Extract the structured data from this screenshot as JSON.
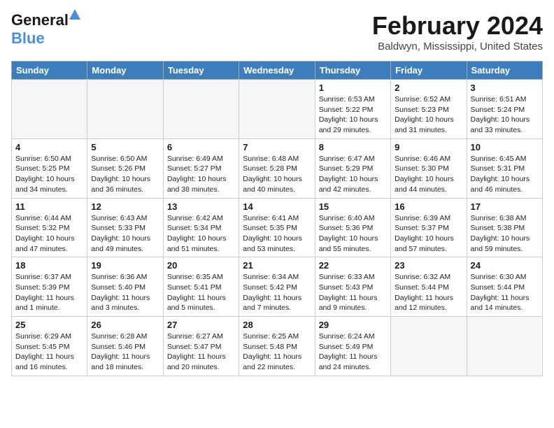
{
  "header": {
    "logo_line1": "General",
    "logo_line2": "Blue",
    "title": "February 2024",
    "subtitle": "Baldwyn, Mississippi, United States"
  },
  "days_of_week": [
    "Sunday",
    "Monday",
    "Tuesday",
    "Wednesday",
    "Thursday",
    "Friday",
    "Saturday"
  ],
  "weeks": [
    [
      {
        "day": "",
        "info": ""
      },
      {
        "day": "",
        "info": ""
      },
      {
        "day": "",
        "info": ""
      },
      {
        "day": "",
        "info": ""
      },
      {
        "day": "1",
        "info": "Sunrise: 6:53 AM\nSunset: 5:22 PM\nDaylight: 10 hours\nand 29 minutes."
      },
      {
        "day": "2",
        "info": "Sunrise: 6:52 AM\nSunset: 5:23 PM\nDaylight: 10 hours\nand 31 minutes."
      },
      {
        "day": "3",
        "info": "Sunrise: 6:51 AM\nSunset: 5:24 PM\nDaylight: 10 hours\nand 33 minutes."
      }
    ],
    [
      {
        "day": "4",
        "info": "Sunrise: 6:50 AM\nSunset: 5:25 PM\nDaylight: 10 hours\nand 34 minutes."
      },
      {
        "day": "5",
        "info": "Sunrise: 6:50 AM\nSunset: 5:26 PM\nDaylight: 10 hours\nand 36 minutes."
      },
      {
        "day": "6",
        "info": "Sunrise: 6:49 AM\nSunset: 5:27 PM\nDaylight: 10 hours\nand 38 minutes."
      },
      {
        "day": "7",
        "info": "Sunrise: 6:48 AM\nSunset: 5:28 PM\nDaylight: 10 hours\nand 40 minutes."
      },
      {
        "day": "8",
        "info": "Sunrise: 6:47 AM\nSunset: 5:29 PM\nDaylight: 10 hours\nand 42 minutes."
      },
      {
        "day": "9",
        "info": "Sunrise: 6:46 AM\nSunset: 5:30 PM\nDaylight: 10 hours\nand 44 minutes."
      },
      {
        "day": "10",
        "info": "Sunrise: 6:45 AM\nSunset: 5:31 PM\nDaylight: 10 hours\nand 46 minutes."
      }
    ],
    [
      {
        "day": "11",
        "info": "Sunrise: 6:44 AM\nSunset: 5:32 PM\nDaylight: 10 hours\nand 47 minutes."
      },
      {
        "day": "12",
        "info": "Sunrise: 6:43 AM\nSunset: 5:33 PM\nDaylight: 10 hours\nand 49 minutes."
      },
      {
        "day": "13",
        "info": "Sunrise: 6:42 AM\nSunset: 5:34 PM\nDaylight: 10 hours\nand 51 minutes."
      },
      {
        "day": "14",
        "info": "Sunrise: 6:41 AM\nSunset: 5:35 PM\nDaylight: 10 hours\nand 53 minutes."
      },
      {
        "day": "15",
        "info": "Sunrise: 6:40 AM\nSunset: 5:36 PM\nDaylight: 10 hours\nand 55 minutes."
      },
      {
        "day": "16",
        "info": "Sunrise: 6:39 AM\nSunset: 5:37 PM\nDaylight: 10 hours\nand 57 minutes."
      },
      {
        "day": "17",
        "info": "Sunrise: 6:38 AM\nSunset: 5:38 PM\nDaylight: 10 hours\nand 59 minutes."
      }
    ],
    [
      {
        "day": "18",
        "info": "Sunrise: 6:37 AM\nSunset: 5:39 PM\nDaylight: 11 hours\nand 1 minute."
      },
      {
        "day": "19",
        "info": "Sunrise: 6:36 AM\nSunset: 5:40 PM\nDaylight: 11 hours\nand 3 minutes."
      },
      {
        "day": "20",
        "info": "Sunrise: 6:35 AM\nSunset: 5:41 PM\nDaylight: 11 hours\nand 5 minutes."
      },
      {
        "day": "21",
        "info": "Sunrise: 6:34 AM\nSunset: 5:42 PM\nDaylight: 11 hours\nand 7 minutes."
      },
      {
        "day": "22",
        "info": "Sunrise: 6:33 AM\nSunset: 5:43 PM\nDaylight: 11 hours\nand 9 minutes."
      },
      {
        "day": "23",
        "info": "Sunrise: 6:32 AM\nSunset: 5:44 PM\nDaylight: 11 hours\nand 12 minutes."
      },
      {
        "day": "24",
        "info": "Sunrise: 6:30 AM\nSunset: 5:44 PM\nDaylight: 11 hours\nand 14 minutes."
      }
    ],
    [
      {
        "day": "25",
        "info": "Sunrise: 6:29 AM\nSunset: 5:45 PM\nDaylight: 11 hours\nand 16 minutes."
      },
      {
        "day": "26",
        "info": "Sunrise: 6:28 AM\nSunset: 5:46 PM\nDaylight: 11 hours\nand 18 minutes."
      },
      {
        "day": "27",
        "info": "Sunrise: 6:27 AM\nSunset: 5:47 PM\nDaylight: 11 hours\nand 20 minutes."
      },
      {
        "day": "28",
        "info": "Sunrise: 6:25 AM\nSunset: 5:48 PM\nDaylight: 11 hours\nand 22 minutes."
      },
      {
        "day": "29",
        "info": "Sunrise: 6:24 AM\nSunset: 5:49 PM\nDaylight: 11 hours\nand 24 minutes."
      },
      {
        "day": "",
        "info": ""
      },
      {
        "day": "",
        "info": ""
      }
    ]
  ]
}
